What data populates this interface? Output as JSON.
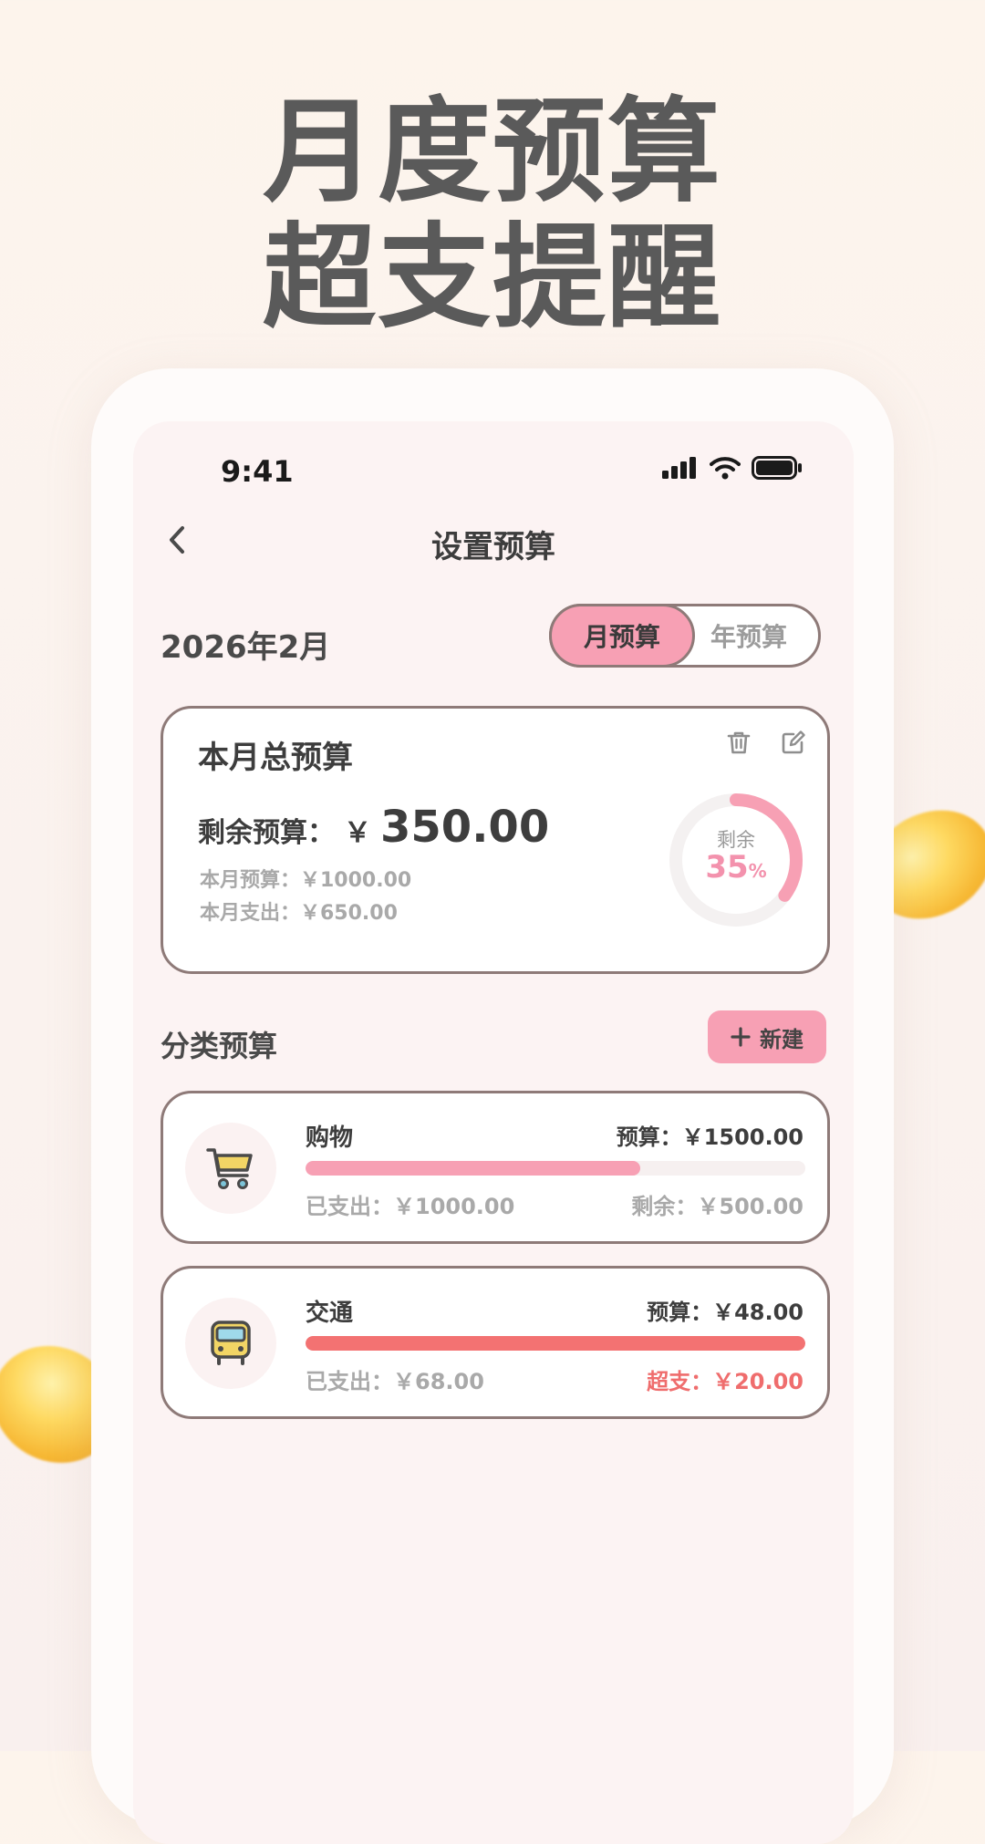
{
  "promo": {
    "line1": "月度预算",
    "line2": "超支提醒"
  },
  "status": {
    "time": "9:41"
  },
  "nav": {
    "title": "设置预算"
  },
  "period": "2026年2月",
  "segment": {
    "active": "月预算",
    "inactive": "年预算"
  },
  "total": {
    "title": "本月总预算",
    "remain_label": "剩余预算：",
    "currency": "￥",
    "remain_amount": "350.00",
    "budget_line": "本月预算：￥1000.00",
    "spent_line": "本月支出：￥650.00",
    "ring_label": "剩余",
    "ring_percent": "35",
    "ring_percent_unit": "%",
    "remaining_ratio": 0.35
  },
  "category_section": {
    "title": "分类预算",
    "new_label": "新建"
  },
  "categories": [
    {
      "name": "购物",
      "icon": "shopping-cart-icon",
      "budget": "预算：￥1500.00",
      "spent": "已支出：￥1000.00",
      "left": "剩余：￥500.00",
      "progress": 0.67,
      "bar_color": "#f7a0b4",
      "over": false
    },
    {
      "name": "交通",
      "icon": "bus-icon",
      "budget": "预算：￥48.00",
      "spent": "已支出：￥68.00",
      "left": "超支：￥20.00",
      "progress": 1.0,
      "bar_color": "#f37272",
      "over": true
    }
  ],
  "colors": {
    "accent": "#f7a0b4",
    "over": "#ef6d6d",
    "border": "#8e7a78"
  }
}
